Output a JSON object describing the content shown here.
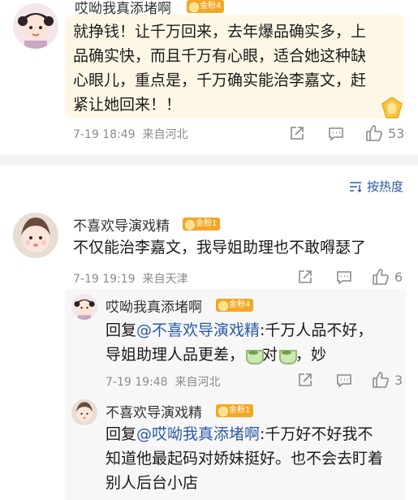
{
  "top_comment": {
    "username": "哎呦我真添堵啊",
    "badge": "金粉4",
    "text_lines": [
      "就挣钱！让千万回来，去年爆品确实多，上",
      "品确实快，而且千万有心眼，适合她这种缺",
      "心眼儿，重点是，千万确实能治李嘉文，赶",
      "紧让她回来！！"
    ],
    "time": "7-19 18:49",
    "location": "来自河北",
    "like_count": "53"
  },
  "sort_label": "按热度",
  "comment2": {
    "username": "不喜欢导演戏精",
    "badge": "金粉1",
    "text": "不仅能治李嘉文，我导姐助理也不敢嘚瑟了",
    "time": "7-19 19:19",
    "location": "来自天津",
    "like_count": "6"
  },
  "reply1": {
    "username": "哎呦我真添堵啊",
    "badge": "金粉4",
    "reply_prefix": "回复",
    "mention": "@不喜欢导演戏精",
    "line1_rest": ":千万人品不好，",
    "line2_a": "导姐助理人品更差，",
    "line2_b": "对",
    "line2_c": "，妙",
    "emoji": "tea-cup-emoji",
    "time": "7-19 19:48",
    "location": "来自河北",
    "like_count": "3"
  },
  "reply2": {
    "username": "不喜欢导演戏精",
    "badge": "金粉1",
    "reply_prefix": "回复",
    "mention": "@哎呦我真添堵啊",
    "line1_rest": ":千万好不好我不",
    "line2": "知道他最起码对娇妹挺好。也不会去盯着",
    "line3": "别人后台小店"
  },
  "colors": {
    "link_blue": "#2b5aa8",
    "badge_gold": "#f5a623",
    "meta_gray": "#8a8a8a"
  }
}
